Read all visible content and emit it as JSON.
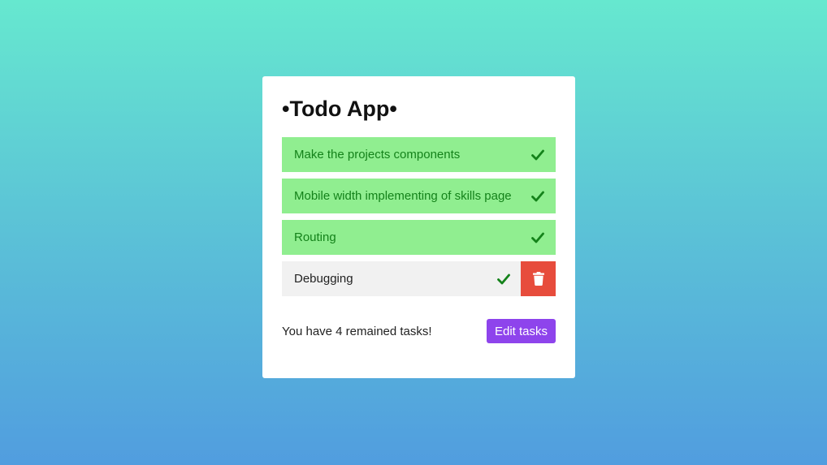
{
  "app": {
    "title": "•Todo App•"
  },
  "tasks": [
    {
      "label": "Make the projects components",
      "status": "done",
      "icon": "check-icon"
    },
    {
      "label": "Mobile width implementing of skills page",
      "status": "done",
      "icon": "check-icon"
    },
    {
      "label": "Routing",
      "status": "done",
      "icon": "check-icon"
    },
    {
      "label": "Debugging",
      "status": "pending",
      "icon": "check-icon",
      "action_icon": "trash-icon"
    }
  ],
  "footer": {
    "remaining_text": "You have 4 remained tasks!",
    "edit_button_label": "Edit tasks"
  },
  "colors": {
    "done_bg": "#90ee90",
    "done_text": "#14821a",
    "pending_bg": "#f1f1f1",
    "delete_bg": "#e74c3c",
    "edit_button_bg": "#8e44ec"
  }
}
